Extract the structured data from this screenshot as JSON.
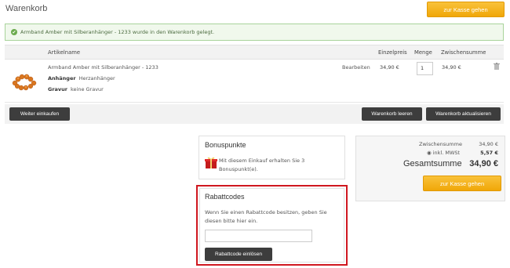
{
  "page": {
    "title": "Warenkorb",
    "checkout_label": "zur Kasse gehen"
  },
  "notice": {
    "text": "Armband Amber mit Silberanhänger - 1233 wurde in den Warenkorb gelegt."
  },
  "cart": {
    "headers": {
      "article": "Artikelname",
      "unit_price": "Einzelpreis",
      "quantity": "Menge",
      "subtotal": "Zwischensumme"
    },
    "items": [
      {
        "name": "Armband Amber mit Silberanhänger - 1233",
        "attributes": [
          {
            "label": "Anhänger",
            "value": "Herzanhänger"
          },
          {
            "label": "Gravur",
            "value": "keine Gravur"
          }
        ],
        "edit_label": "Bearbeiten",
        "unit_price": "34,90 €",
        "quantity": "1",
        "subtotal": "34,90 €",
        "icon": "trash-icon"
      }
    ],
    "actions": {
      "continue": "Weiter einkaufen",
      "clear": "Warenkorb leeren",
      "update": "Warenkorb aktualisieren"
    }
  },
  "bonus": {
    "title": "Bonuspunkte",
    "text": "Mit diesem Einkauf erhalten Sie 3 Bonuspunkt(e).",
    "icon": "gift-icon"
  },
  "totals": {
    "subtotal_label": "Zwischensumme",
    "subtotal_value": "34,90 €",
    "vat_label": "inkl. MWSt",
    "vat_value": "5,57 €",
    "total_label": "Gesamtsumme",
    "total_value": "34,90 €",
    "checkout_label": "zur Kasse gehen"
  },
  "coupon": {
    "title": "Rabattcodes",
    "description": "Wenn Sie einen Rabattcode besitzen, geben Sie diesen bitte hier ein.",
    "input_value": "",
    "button_label": "Rabattcode einlösen"
  },
  "colors": {
    "accent": "#f0a708",
    "dark_button": "#3d3d3d",
    "success_bg": "#f0f8ec",
    "highlight": "#d0171f"
  }
}
